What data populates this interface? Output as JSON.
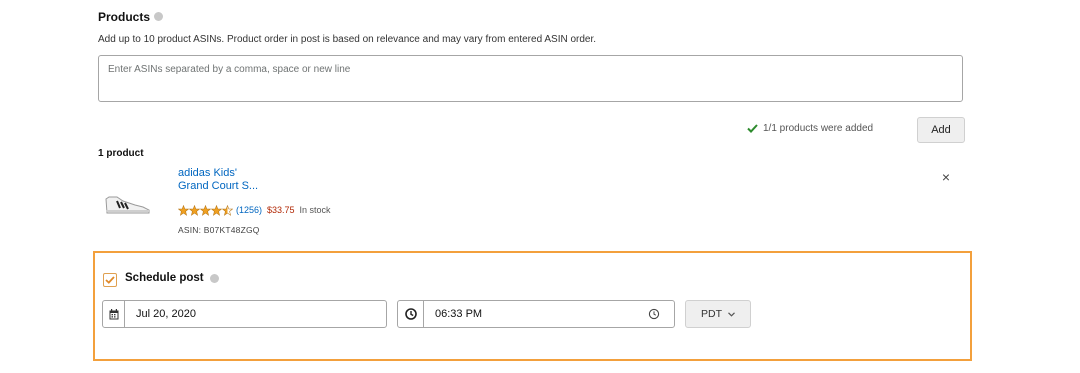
{
  "products": {
    "title": "Products",
    "help_text": "Add up to 10 product ASINs. Product order in post is based on relevance and may vary from entered ASIN order.",
    "input_placeholder": "Enter ASINs separated by a comma, space or new line",
    "added_status": "1/1 products were added",
    "add_label": "Add",
    "count_label": "1 product",
    "items": [
      {
        "title_line1": "adidas Kids'",
        "title_line2": "Grand Court S...",
        "rating": 4.5,
        "reviews": "(1256)",
        "price": "$33.75",
        "stock": "In stock",
        "asin": "ASIN: B07KT48ZGQ",
        "image_icon": "sneaker-icon",
        "remove_label": "×"
      }
    ]
  },
  "schedule": {
    "checked": true,
    "label": "Schedule post",
    "date": "Jul 20, 2020",
    "date_icon": "calendar-icon",
    "time": "06:33 PM",
    "time_icon": "clock-icon",
    "timezone": "PDT"
  },
  "colors": {
    "link": "#0066c0",
    "price": "#b12704",
    "highlight": "#f3a03c",
    "success": "#2e8b2e",
    "star": "#f0a020"
  }
}
